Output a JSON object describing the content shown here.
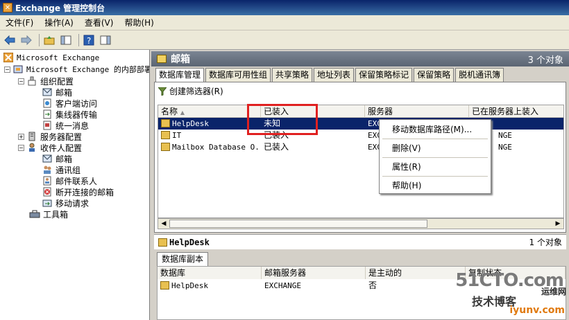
{
  "window": {
    "title": "Exchange 管理控制台"
  },
  "menu": [
    "文件(F)",
    "操作(A)",
    "查看(V)",
    "帮助(H)"
  ],
  "toolbar": {
    "icons": [
      "back-arrow-icon",
      "forward-arrow-icon",
      "folder-up-icon",
      "console-tree-icon",
      "help-icon",
      "action-pane-icon"
    ]
  },
  "tree": {
    "items": [
      {
        "label": "Microsoft Exchange",
        "icon": "exchange-icon",
        "expander": ""
      },
      {
        "label": "Microsoft Exchange 的内部部署",
        "icon": "org-icon",
        "expander": "−"
      },
      {
        "label": "组织配置",
        "icon": "org-config-icon",
        "expander": "−"
      },
      {
        "label": "邮箱",
        "icon": "mailbox-icon",
        "expander": ""
      },
      {
        "label": "客户端访问",
        "icon": "client-access-icon",
        "expander": ""
      },
      {
        "label": "集线器传输",
        "icon": "hub-transport-icon",
        "expander": ""
      },
      {
        "label": "统一消息",
        "icon": "unified-messaging-icon",
        "expander": ""
      },
      {
        "label": "服务器配置",
        "icon": "server-config-icon",
        "expander": "+"
      },
      {
        "label": "收件人配置",
        "icon": "recipient-config-icon",
        "expander": "−"
      },
      {
        "label": "邮箱",
        "icon": "mailbox-icon",
        "expander": ""
      },
      {
        "label": "通讯组",
        "icon": "distribution-group-icon",
        "expander": ""
      },
      {
        "label": "邮件联系人",
        "icon": "mail-contact-icon",
        "expander": ""
      },
      {
        "label": "断开连接的邮箱",
        "icon": "disconnected-mailbox-icon",
        "expander": ""
      },
      {
        "label": "移动请求",
        "icon": "move-request-icon",
        "expander": ""
      },
      {
        "label": "工具箱",
        "icon": "toolbox-icon",
        "expander": ""
      }
    ]
  },
  "main": {
    "title": "邮箱",
    "count": "3 个对象",
    "tabs": [
      "数据库管理",
      "数据库可用性组",
      "共享策略",
      "地址列表",
      "保留策略标记",
      "保留策略",
      "脱机通讯簿"
    ],
    "filter_label": "创建筛选器(R)",
    "columns": [
      "名称",
      "已装入",
      "服务器",
      "已在服务器上装入"
    ],
    "rows": [
      {
        "name": "HelpDesk",
        "mounted": "未知",
        "server": "EXCHANGE",
        "mounted_on": ""
      },
      {
        "name": "IT",
        "mounted": "已装入",
        "server": "EXCHANGE",
        "mounted_on": "EXCHANGE"
      },
      {
        "name": "Mailbox Database O...",
        "mounted": "已装入",
        "server": "EXCHANGE",
        "mounted_on": "EXCHANGE"
      }
    ],
    "server_partial": [
      "EXCHANGE",
      "EXC",
      "EXC"
    ],
    "mounted_on_partial": [
      "",
      "NGE",
      "NGE"
    ]
  },
  "context_menu": {
    "items": [
      "移动数据库路径(M)...",
      "删除(V)",
      "属性(R)",
      "帮助(H)"
    ]
  },
  "detail": {
    "title": "HelpDesk",
    "count": "1 个对象",
    "tab": "数据库副本",
    "columns": [
      "数据库",
      "邮箱服务器",
      "是主动的",
      "复制状态"
    ],
    "rows": [
      {
        "database": "HelpDesk",
        "server": "EXCHANGE",
        "active": "否",
        "status": ""
      }
    ]
  },
  "watermark": {
    "big": "51CTO.com",
    "small": "技术博客",
    "cn": "运维网",
    "url": "iyunv.com"
  }
}
